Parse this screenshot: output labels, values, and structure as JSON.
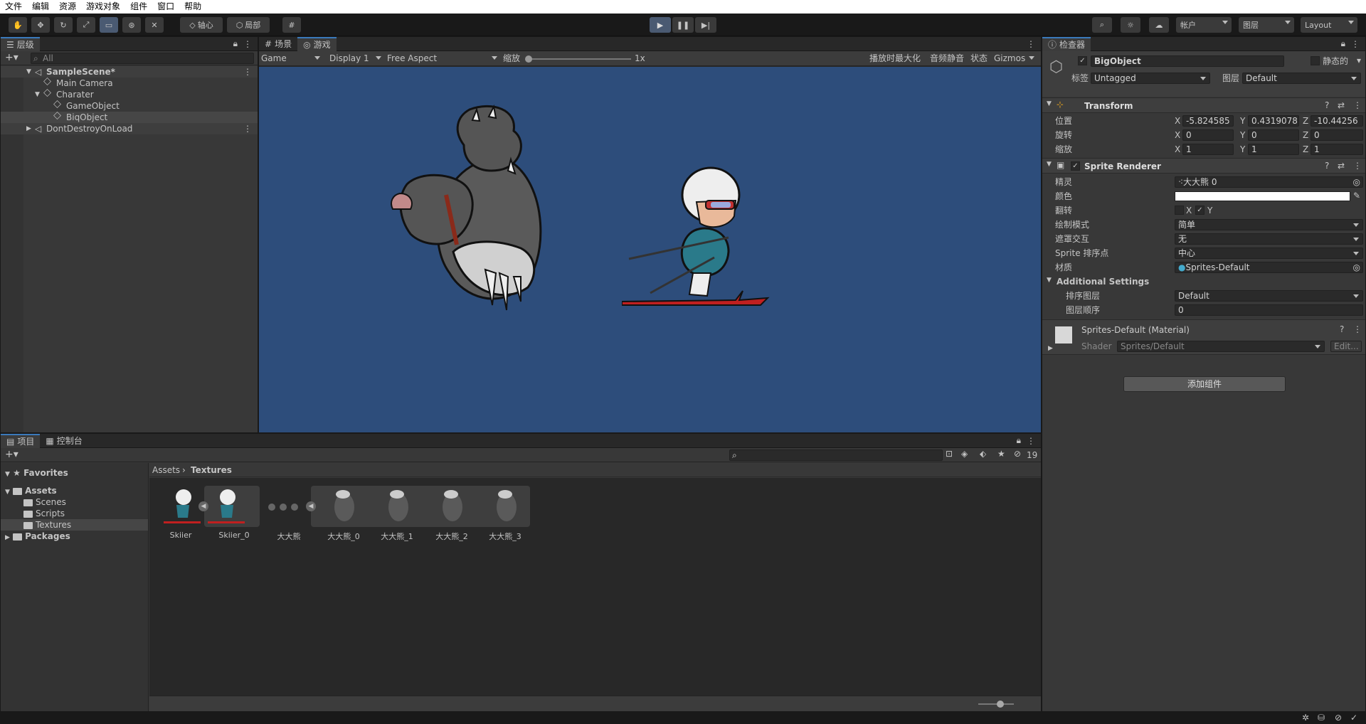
{
  "menu": [
    "文件",
    "编辑",
    "资源",
    "游戏对象",
    "组件",
    "窗口",
    "帮助"
  ],
  "toolbar": {
    "pivot_label": "轴心",
    "local_label": "局部",
    "account_label": "帐户",
    "layers_label": "图层",
    "layout_label": "Layout"
  },
  "hierarchy": {
    "tab": "层级",
    "search_placeholder": "All",
    "items": [
      {
        "label": "SampleScene*"
      },
      {
        "label": "Main Camera"
      },
      {
        "label": "Charater"
      },
      {
        "label": "GameObject"
      },
      {
        "label": "BiqObject"
      },
      {
        "label": "DontDestroyOnLoad"
      }
    ]
  },
  "game": {
    "tab_scene": "场景",
    "tab_game": "游戏",
    "mode": "Game",
    "display": "Display 1",
    "aspect": "Free Aspect",
    "scale_label": "缩放",
    "scale_value": "1x",
    "maximize": "播放时最大化",
    "mute": "音频静音",
    "stats": "状态",
    "gizmos": "Gizmos",
    "bg_color": "#2d4d7b"
  },
  "inspector": {
    "tab": "检查器",
    "object_name": "BigObject",
    "static_label": "静态的",
    "tag_label": "标签",
    "tag_value": "Untagged",
    "layer_label": "图层",
    "layer_value": "Default",
    "transform": {
      "title": "Transform",
      "position_label": "位置",
      "rotation_label": "旋转",
      "scale_label": "缩放",
      "pos": [
        "-5.824585",
        "0.4319078",
        "-10.44256"
      ],
      "rot": [
        "0",
        "0",
        "0"
      ],
      "scl": [
        "1",
        "1",
        "1"
      ]
    },
    "sprite_renderer": {
      "title": "Sprite Renderer",
      "sprite_label": "精灵",
      "sprite_value": "大大熊 0",
      "color_label": "颜色",
      "flip_label": "翻转",
      "flip_x": "X",
      "flip_y": "Y",
      "draw_mode_label": "绘制模式",
      "draw_mode_value": "简单",
      "mask_label": "遮罩交互",
      "mask_value": "无",
      "sort_point_label": "Sprite 排序点",
      "sort_point_value": "中心",
      "material_label": "材质",
      "material_value": "Sprites-Default",
      "additional": "Additional Settings",
      "sort_layer_label": "排序图层",
      "sort_layer_value": "Default",
      "order_label": "图层顺序",
      "order_value": "0"
    },
    "material": {
      "title": "Sprites-Default (Material)",
      "shader_label": "Shader",
      "shader_value": "Sprites/Default",
      "edit_label": "Edit..."
    },
    "add_component": "添加组件"
  },
  "project": {
    "tab_project": "项目",
    "tab_console": "控制台",
    "hidden_count": "19",
    "favorites": "Favorites",
    "assets": "Assets",
    "folders": [
      "Scenes",
      "Scripts",
      "Textures"
    ],
    "packages": "Packages",
    "breadcrumb": [
      "Assets",
      "Textures"
    ],
    "items": [
      "Skiier",
      "Skiier_0",
      "大大熊",
      "大大熊_0",
      "大大熊_1",
      "大大熊_2",
      "大大熊_3"
    ]
  }
}
